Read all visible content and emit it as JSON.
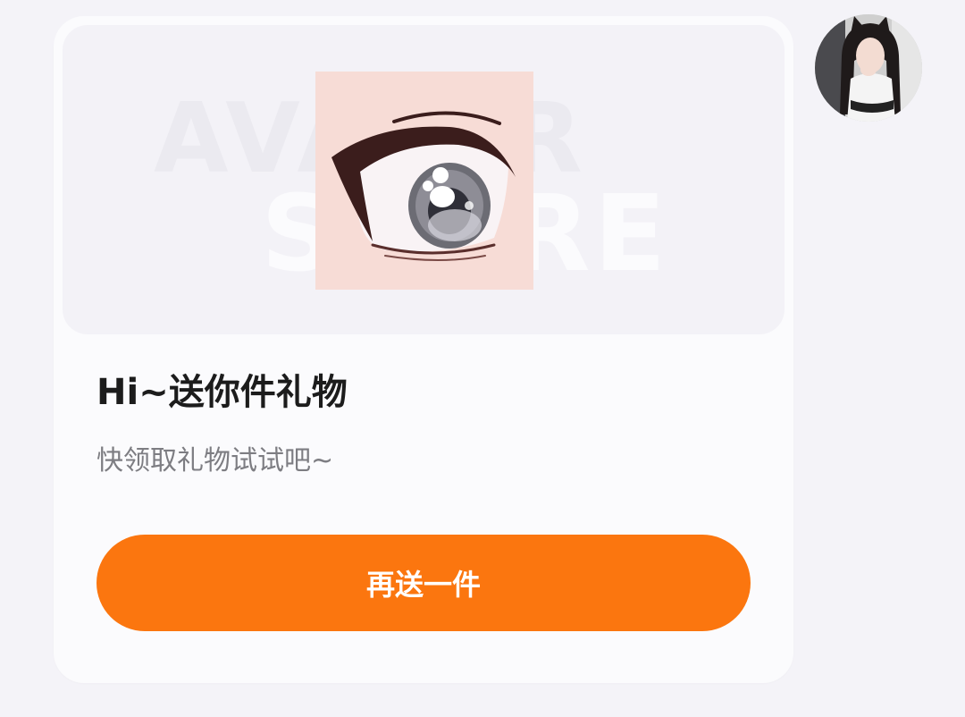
{
  "gift_card": {
    "banner": {
      "watermark_line1": "AVATAR",
      "watermark_line2": "STORE",
      "item_icon": "anime-eye-icon"
    },
    "title": "Hi~送你件礼物",
    "subtitle": "快领取礼物试试吧~",
    "send_button_label": "再送一件"
  },
  "sender": {
    "avatar_icon": "user-avatar-photo"
  },
  "colors": {
    "page_background": "#f4f3f8",
    "card_background": "#fbfbfd",
    "accent": "#fb760f",
    "title_text": "#1c1c1c",
    "subtitle_text": "#7d7d82"
  }
}
